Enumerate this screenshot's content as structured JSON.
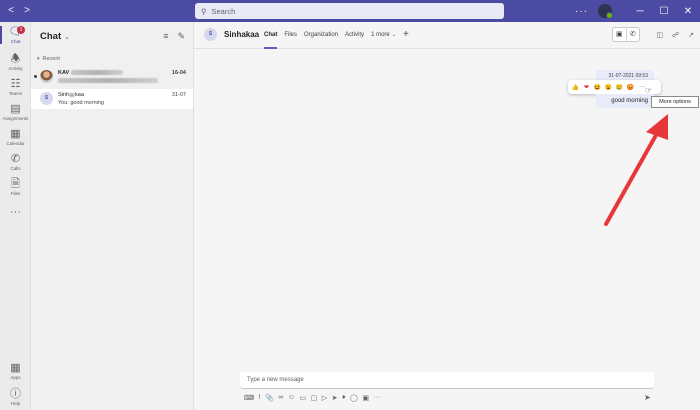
{
  "titlebar": {
    "back_icon": "chevron-left-icon",
    "forward_icon": "chevron-right-icon",
    "search_placeholder": "Search",
    "more_label": "···",
    "min_label": "─",
    "max_label": "☐",
    "close_label": "✕"
  },
  "rail": {
    "items": [
      {
        "label": "Chat",
        "icon": "chat-icon",
        "badge": "1"
      },
      {
        "label": "Activity",
        "icon": "bell-icon"
      },
      {
        "label": "Teams",
        "icon": "teams-icon"
      },
      {
        "label": "Assignments",
        "icon": "assignments-icon"
      },
      {
        "label": "Calendar",
        "icon": "calendar-icon"
      },
      {
        "label": "Calls",
        "icon": "phone-icon"
      },
      {
        "label": "Files",
        "icon": "file-icon"
      }
    ],
    "more_label": "···",
    "bottom": [
      {
        "label": "Apps",
        "icon": "apps-icon"
      },
      {
        "label": "Help",
        "icon": "help-icon"
      }
    ]
  },
  "chatlist": {
    "title": "Chat",
    "section": "Recent",
    "items": [
      {
        "name": "KAV",
        "preview": "",
        "time": "16-04",
        "unread": true
      },
      {
        "name_a": "Sinh",
        "name_b": "kaa",
        "avatar": "S",
        "preview": "You: good morning",
        "time": "31-07"
      }
    ]
  },
  "main": {
    "avatar": "S",
    "name": "Sinhakaa",
    "tabs": [
      "Chat",
      "Files",
      "Organization",
      "Activity",
      "1 more"
    ],
    "add_tab": "+",
    "message": {
      "timestamp": "31-07-2021 09:53",
      "text": "good morning",
      "reactions": [
        "👍",
        "❤",
        "😆",
        "😮",
        "😢",
        "😡"
      ],
      "more_tooltip": "More options"
    },
    "compose_placeholder": "Type a new message"
  },
  "colors": {
    "accent": "#4b4ba3",
    "arrow": "#e8373a",
    "bubble": "#e8ebfa"
  }
}
